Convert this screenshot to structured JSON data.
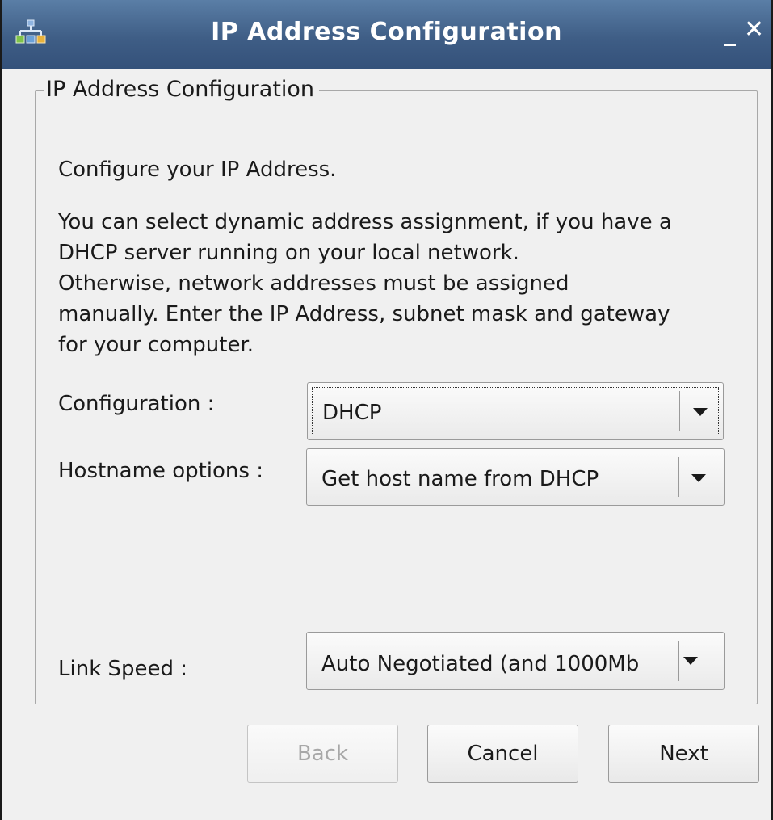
{
  "window": {
    "title": "IP Address Configuration",
    "minimize_glyph": "_",
    "close_glyph": "✕",
    "icon": "network-icon"
  },
  "group": {
    "legend": "IP Address Configuration"
  },
  "intro": "Configure your IP Address.",
  "description_lines": [
    "You can select dynamic address assignment, if you have a",
    "DHCP server running on your local network.",
    "Otherwise, network addresses must be assigned",
    "manually. Enter the IP Address, subnet mask and gateway",
    "for your computer."
  ],
  "configuration": {
    "label": "Configuration :",
    "value": "DHCP"
  },
  "hostname": {
    "label": "Hostname options :",
    "value": "Get host name from DHCP"
  },
  "link_speed": {
    "label": "Link Speed :",
    "value": "Auto Negotiated (and 1000Mb"
  },
  "buttons": {
    "back": "Back",
    "cancel": "Cancel",
    "next": "Next"
  },
  "colors": {
    "titlebar": "#3f5e86",
    "window_bg": "#f0f0f0",
    "disabled_text": "#a8a8a8"
  }
}
